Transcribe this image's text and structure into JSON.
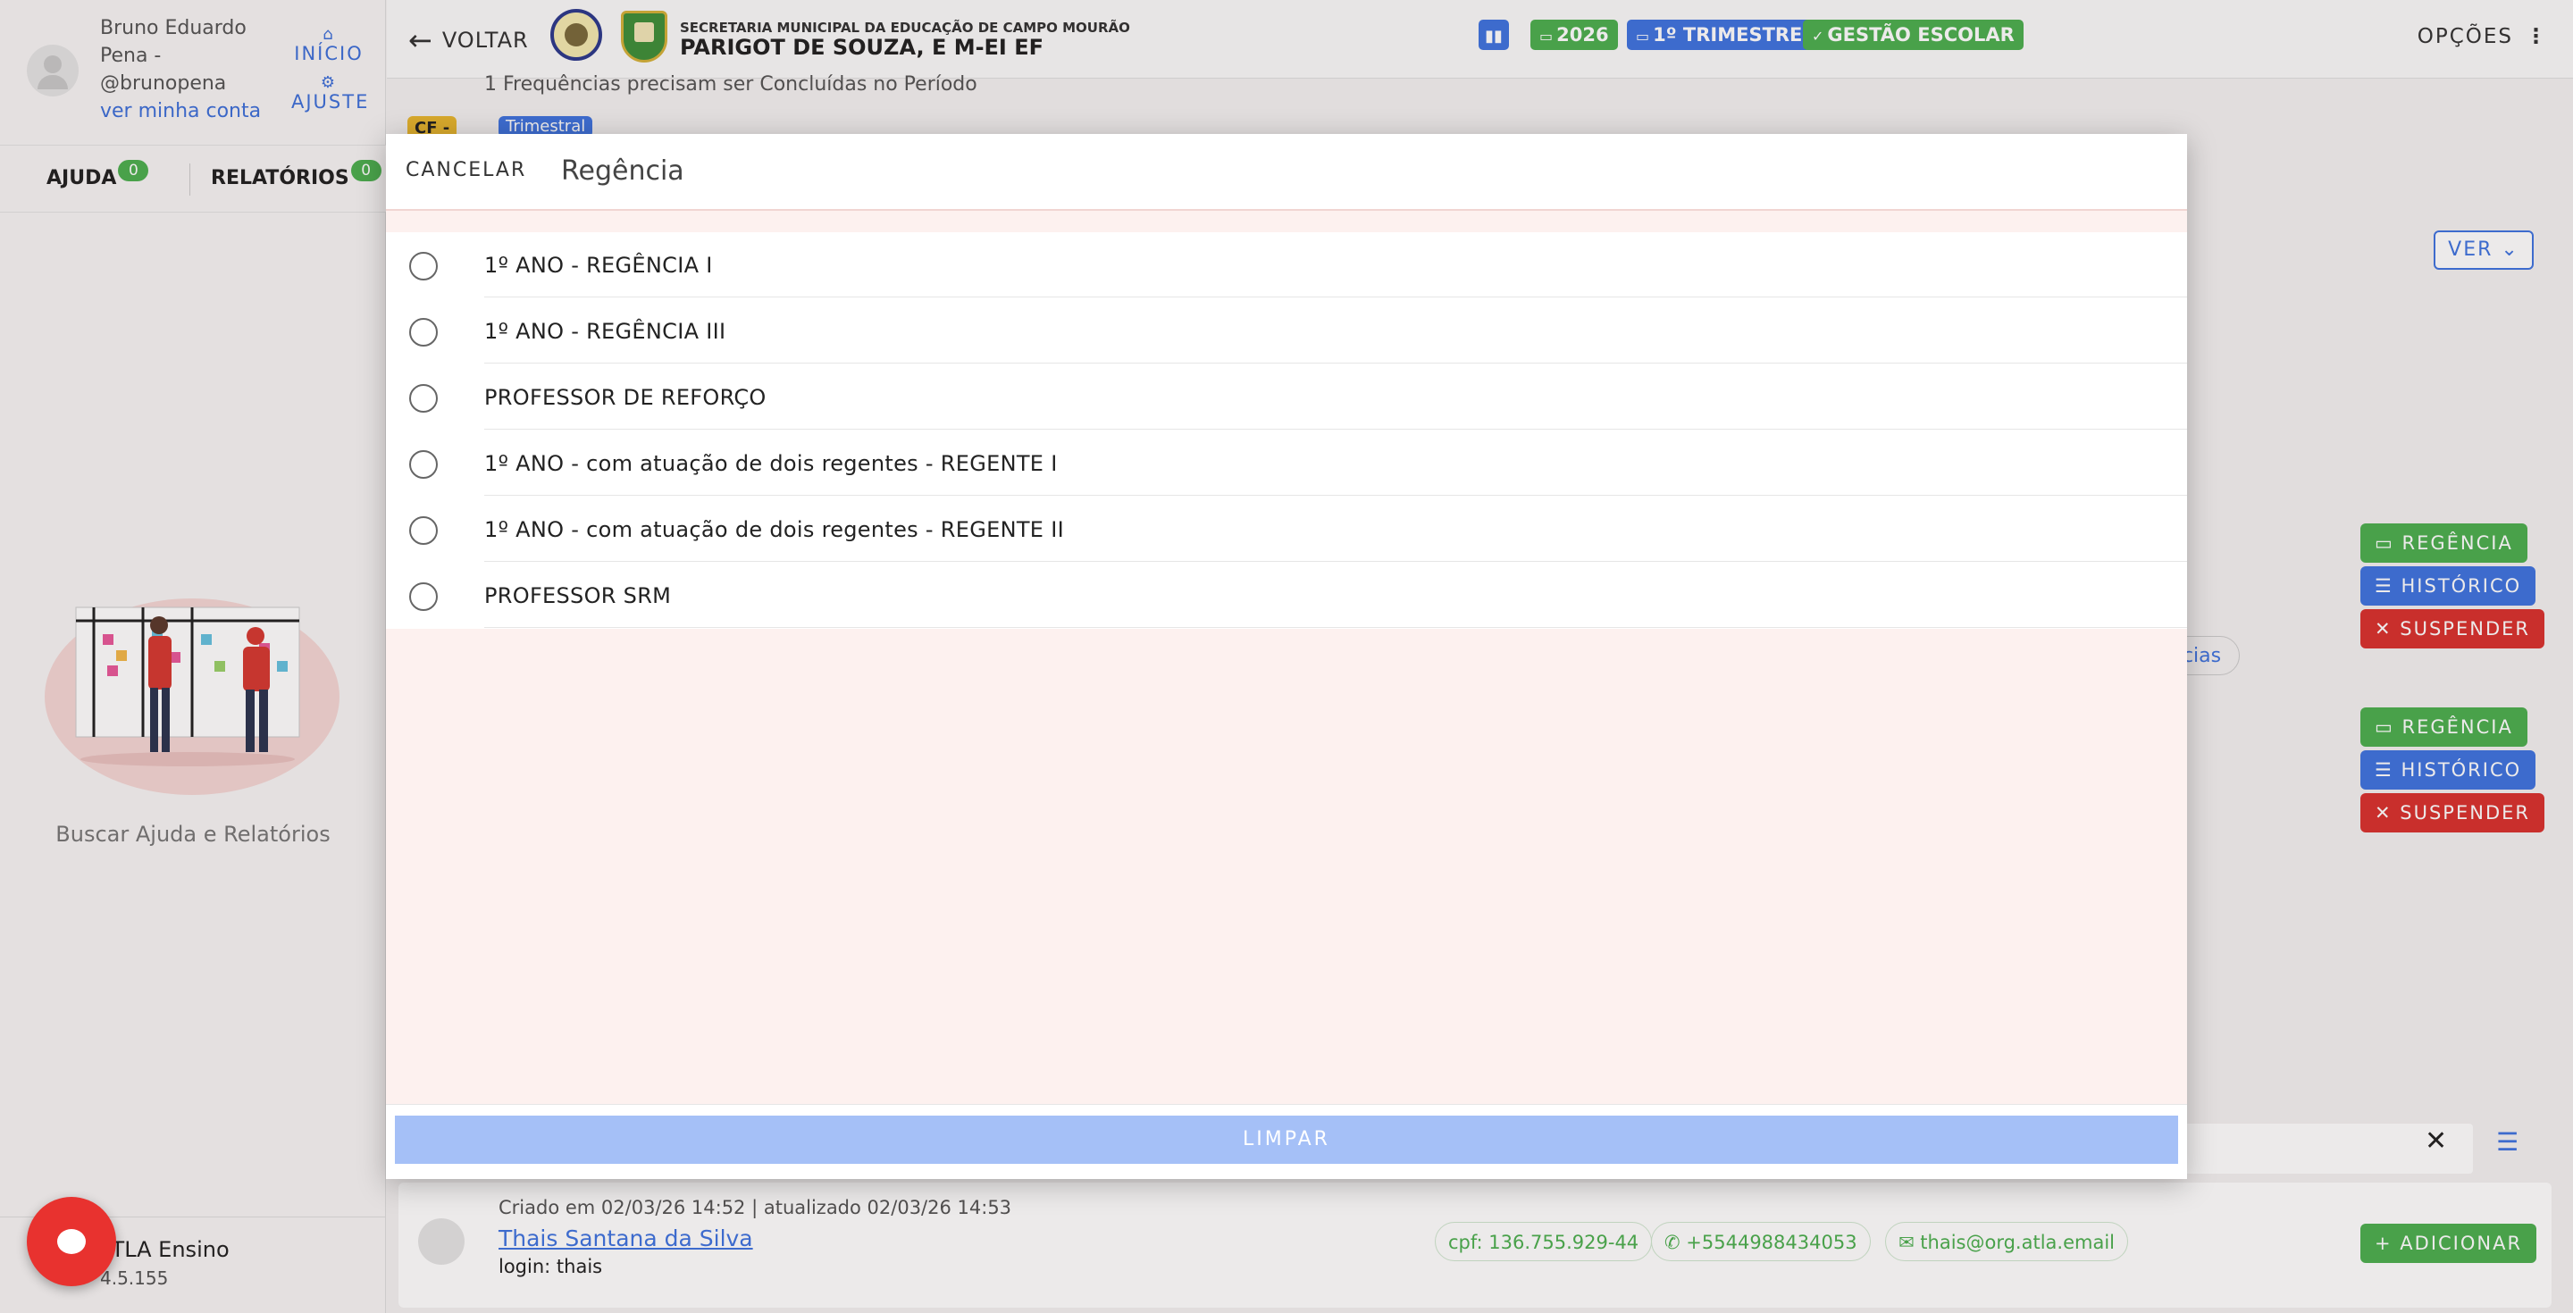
{
  "sidebar": {
    "user_name": "Bruno Eduardo Pena - @brunopena",
    "account_link": "ver minha conta",
    "home_label": "INÍCIO",
    "settings_label": "AJUSTE",
    "tabs": [
      {
        "label": "AJUDA",
        "count": "0"
      },
      {
        "label": "RELATÓRIOS",
        "count": "0"
      }
    ],
    "help_text": "Buscar Ajuda e Relatórios",
    "app_name": "ATLA Ensino",
    "app_version": "4.5.155"
  },
  "topbar": {
    "back_label": "VOLTAR",
    "school_subtitle": "SECRETARIA MUNICIPAL DA EDUCAÇÃO DE CAMPO MOURÃO",
    "school_name": "PARIGOT DE SOUZA, E M-EI EF",
    "year": "2026",
    "period": "1º TRIMESTRE",
    "module": "GESTÃO ESCOLAR",
    "options_label": "OPÇÕES"
  },
  "background": {
    "notice": "1 Frequências precisam ser Concluídas no Período",
    "tag_cf": "CF -",
    "tag_trimestral": "Trimestral",
    "ver_label": "VER",
    "regencia_label": "REGÊNCIA",
    "historico_label": "HISTÓRICO",
    "suspender_label": "SUSPENDER",
    "partial_link": "ncias",
    "created_text": "Criado em 02/03/26 14:52 | atualizado 02/03/26 14:53",
    "person_name": "Thais Santana da Silva",
    "login": "login: thais",
    "cpf": "cpf: 136.755.929-44",
    "phone": "+5544988434053",
    "email": "thais@org.atla.email",
    "add_label": "ADICIONAR"
  },
  "modal": {
    "cancel_label": "CANCELAR",
    "title": "Regência",
    "options": [
      "1º ANO - REGÊNCIA I",
      "1º ANO - REGÊNCIA III",
      "PROFESSOR DE REFORÇO",
      "1º ANO - com atuação de dois regentes - REGENTE I",
      "1º ANO - com atuação de dois regentes - REGENTE II",
      "PROFESSOR SRM"
    ],
    "clear_label": "LIMPAR"
  },
  "colors": {
    "accent_blue": "#3f74e0",
    "success_green": "#4caf50",
    "danger_red": "#d9322f",
    "modal_bg": "#fdf1ef",
    "disabled_blue": "#a5c0f7"
  }
}
